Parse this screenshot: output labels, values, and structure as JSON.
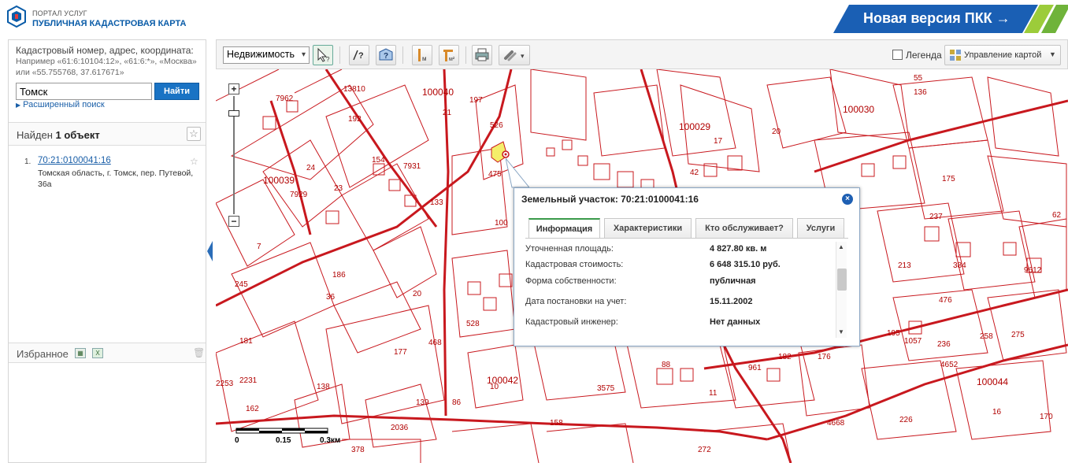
{
  "header": {
    "portal_label": "ПОРТАЛ УСЛУГ",
    "title": "ПУБЛИЧНАЯ КАДАСТРОВАЯ КАРТА",
    "new_version_label": "Новая версия ПКК →",
    "accent_color": "#0a5ca8",
    "new_version_color": "#1a5fb4"
  },
  "search": {
    "hint": "Кадастровый номер, адрес, координата:",
    "examples": "Например «61:6:10104:12», «61:6:*», «Москва» или «55.755768, 37.617671»",
    "value": "Томск",
    "button_label": "Найти",
    "advanced_label": "Расширенный поиск"
  },
  "results": {
    "title_prefix": "Найден",
    "title_count": "1 объект",
    "items": [
      {
        "num": "1.",
        "number": "70:21:0100041:16",
        "address": "Томская область, г. Томск, пер. Путевой, 36а"
      }
    ]
  },
  "favorites": {
    "title": "Избранное"
  },
  "toolbar": {
    "object_type": "Недвижимость",
    "legend_label": "Легенда",
    "map_control_label": "Управление картой"
  },
  "map": {
    "labels": [
      {
        "text": "100040"
      },
      {
        "text": "100029"
      },
      {
        "text": "100030"
      },
      {
        "text": "100039"
      },
      {
        "text": "100042"
      },
      {
        "text": "100044"
      },
      {
        "text": "24"
      },
      {
        "text": "23"
      },
      {
        "text": "7"
      },
      {
        "text": "245"
      },
      {
        "text": "177"
      },
      {
        "text": "138"
      },
      {
        "text": "162"
      },
      {
        "text": "139"
      },
      {
        "text": "86"
      },
      {
        "text": "10"
      },
      {
        "text": "17"
      },
      {
        "text": "20"
      },
      {
        "text": "175"
      },
      {
        "text": "16"
      },
      {
        "text": "226"
      },
      {
        "text": "4668"
      },
      {
        "text": "11"
      },
      {
        "text": "158"
      },
      {
        "text": "2036"
      },
      {
        "text": "2231"
      },
      {
        "text": "2253"
      },
      {
        "text": "181"
      },
      {
        "text": "186"
      },
      {
        "text": "36"
      },
      {
        "text": "20"
      },
      {
        "text": "528"
      },
      {
        "text": "468"
      },
      {
        "text": "21"
      },
      {
        "text": "197"
      },
      {
        "text": "526"
      },
      {
        "text": "475"
      },
      {
        "text": "133"
      },
      {
        "text": "7931"
      },
      {
        "text": "7929"
      },
      {
        "text": "7962"
      },
      {
        "text": "13810"
      },
      {
        "text": "192"
      },
      {
        "text": "154"
      },
      {
        "text": "55"
      },
      {
        "text": "136"
      },
      {
        "text": "213"
      },
      {
        "text": "384"
      },
      {
        "text": "476"
      },
      {
        "text": "237"
      },
      {
        "text": "195"
      },
      {
        "text": "1057"
      },
      {
        "text": "236"
      },
      {
        "text": "258"
      },
      {
        "text": "275"
      },
      {
        "text": "4652"
      },
      {
        "text": "9612"
      },
      {
        "text": "62"
      },
      {
        "text": "3575"
      },
      {
        "text": "961"
      },
      {
        "text": "176"
      },
      {
        "text": "272"
      },
      {
        "text": "378"
      },
      {
        "text": "42"
      },
      {
        "text": "88"
      },
      {
        "text": "182"
      },
      {
        "text": "170"
      },
      {
        "text": "100"
      }
    ],
    "scale": {
      "lbl0": "0",
      "lbl1": "0.15",
      "lbl2": "0.3км"
    }
  },
  "popup": {
    "title": "Земельный участок: 70:21:0100041:16",
    "close": "×",
    "tabs": [
      "Информация",
      "Характеристики",
      "Кто обслуживает?",
      "Услуги"
    ],
    "rows": [
      {
        "label": "Уточненная площадь:",
        "value": "4 827.80 кв. м"
      },
      {
        "label": "Кадастровая стоимость:",
        "value": "6 648 315.10 руб."
      },
      {
        "label": "Форма собственности:",
        "value": "публичная"
      },
      {
        "label": "Дата постановки на учет:",
        "value": "15.11.2002"
      },
      {
        "label": "Кадастровый инженер:",
        "value": "Нет данных"
      }
    ]
  }
}
